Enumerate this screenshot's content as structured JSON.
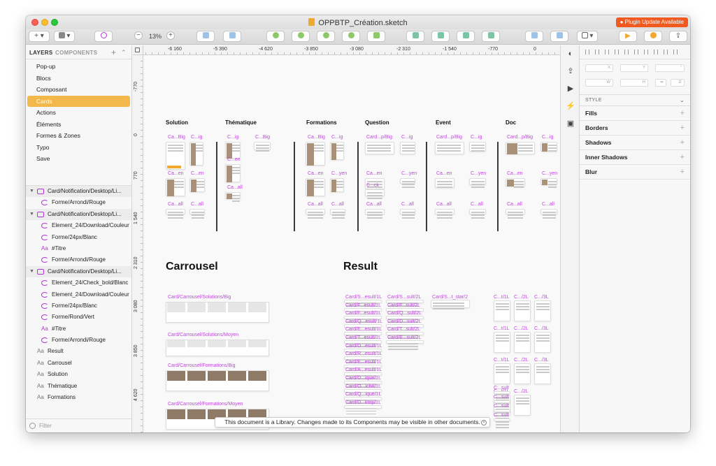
{
  "window": {
    "title": "OPPBTP_Création.sketch",
    "plugin_badge": "● Plugin Update Available"
  },
  "toolbar": {
    "zoom": "13%",
    "insert": "+",
    "zoom_minus": "−",
    "zoom_plus": "+"
  },
  "sidebar": {
    "tabs": [
      "LAYERS",
      "COMPONENTS"
    ],
    "pages": [
      "Pop-up",
      "Blocs",
      "Composant",
      "Cards",
      "Actions",
      "Éléments",
      "Formes & Zones",
      "Typo",
      "Save"
    ],
    "selected_page": "Cards",
    "layers": [
      {
        "kind": "group",
        "label": "Card/Notification/Desktop/Li..."
      },
      {
        "kind": "symbol",
        "label": "Forme/Arrondi/Rouge"
      },
      {
        "kind": "group",
        "label": "Card/Notification/Desktop/Li..."
      },
      {
        "kind": "symbol",
        "label": "Element_24/Download/Couleur"
      },
      {
        "kind": "symbol",
        "label": "Forme/24px/Blanc"
      },
      {
        "kind": "text",
        "label": "#Titre"
      },
      {
        "kind": "symbol",
        "label": "Forme/Arrondi/Rouge"
      },
      {
        "kind": "group",
        "label": "Card/Notification/Desktop/Li..."
      },
      {
        "kind": "symbol",
        "label": "Element_24/Check_bold/Blanc"
      },
      {
        "kind": "symbol",
        "label": "Element_24/Download/Couleur"
      },
      {
        "kind": "symbol",
        "label": "Forme/24px/Blanc"
      },
      {
        "kind": "symbol",
        "label": "Forme/Rond/Vert"
      },
      {
        "kind": "text",
        "label": "#Titre"
      },
      {
        "kind": "symbol",
        "label": "Forme/Arrondi/Rouge"
      },
      {
        "kind": "text-gray",
        "label": "Result"
      },
      {
        "kind": "text-gray",
        "label": "Carrousel"
      },
      {
        "kind": "text-gray",
        "label": "Solution"
      },
      {
        "kind": "text-gray",
        "label": "Thématique"
      },
      {
        "kind": "text-gray",
        "label": "Formations"
      }
    ],
    "filter_placeholder": "Filter"
  },
  "canvas": {
    "ruler_x": [
      "-6 160",
      "-5 390",
      "-4 620",
      "-3 850",
      "-3 080",
      "-2 310",
      "-1 540",
      "-770",
      "0"
    ],
    "ruler_y": [
      "-770",
      "0",
      "770",
      "1 540",
      "2 310",
      "3 080",
      "3 850",
      "4 620"
    ],
    "sections": [
      "Solution",
      "Thématique",
      "Formations",
      "Question",
      "Event",
      "Doc"
    ],
    "big_titles": [
      "Carrousel",
      "Result"
    ],
    "artboard_labels": {
      "sol": [
        "Ca...Big",
        "C...ig",
        "Ca...en",
        "C...en",
        "Ca...all",
        "C...all"
      ],
      "them": [
        "C...ig",
        "C...Big",
        "C...en",
        "Ca...all"
      ],
      "form": [
        "Ca...Big",
        "C...ig",
        "Ca...en",
        "C...yen",
        "Ca...all",
        "C...all"
      ],
      "quest": [
        "Card...p/Big",
        "C...ig",
        "Ca...en",
        "C...yen",
        "Ca...all",
        "C...all",
        "C...ck"
      ],
      "event": [
        "Card...p/Big",
        "C...ig",
        "Ca...en",
        "C...yen",
        "Ca...all",
        "C...all"
      ],
      "doc": [
        "Card...p/Big",
        "C...ig",
        "Ca...en",
        "C...yen",
        "Ca...all",
        "C...all"
      ],
      "carrousel": [
        "Card/Carrousel/Solutions/Big",
        "Card/Carrousel/Solutions/Moyen",
        "Card/Carrousel/Formations/Big",
        "Card/Carrousel/Formations/Moyen",
        "Card/Carrousel/Questions/Big"
      ],
      "result_col1": [
        "Card/S...esult/1L",
        "Card/F...esult/1L",
        "Card/F...esult/1L",
        "Card/Q...esult/1L",
        "Card/E...esult/1L",
        "Card/T...esult/1L",
        "Card/D...esult/1L",
        "Card/R...esult/1L",
        "Card/E...esult/1L",
        "Card/A...esult/1L",
        "Card/D...ique/1L",
        "Card/O...iché/1L",
        "Card/Q...ique/1L",
        "Card/D...ktop/1L"
      ],
      "result_col2": [
        "Card/S...sult/2L",
        "Card/F...sult/2L",
        "Card/Q...sult/2L",
        "Card/D...sult/2L",
        "Card/T...sult/2L",
        "Card/E...sult/2L"
      ],
      "result_col3": [
        "Card/S...t_star/2"
      ],
      "result_col4": [
        "C...t/1L",
        "C.../2L",
        "C.../3L",
        "C...t/1L",
        "C.../2L",
        "C.../3L",
        "C...t/1L",
        "C.../2L",
        "C.../3L",
        "C...t/1L",
        "C.../2L",
        "C...sult",
        "C...sult",
        "C...sult",
        "C...sult"
      ]
    },
    "toast": "This document is a Library. Changes made to its Components may be visible in other documents."
  },
  "inspector": {
    "fields": [
      "X",
      "Y",
      "°",
      "W",
      "H"
    ],
    "style_header": "STYLE",
    "properties": [
      "Fills",
      "Borders",
      "Shadows",
      "Inner Shadows",
      "Blur"
    ]
  },
  "colors": {
    "accent": "#f3b84b",
    "artboard_label": "#c145e0",
    "symbol": "#b535d6",
    "plugin": "#f05a1e"
  }
}
